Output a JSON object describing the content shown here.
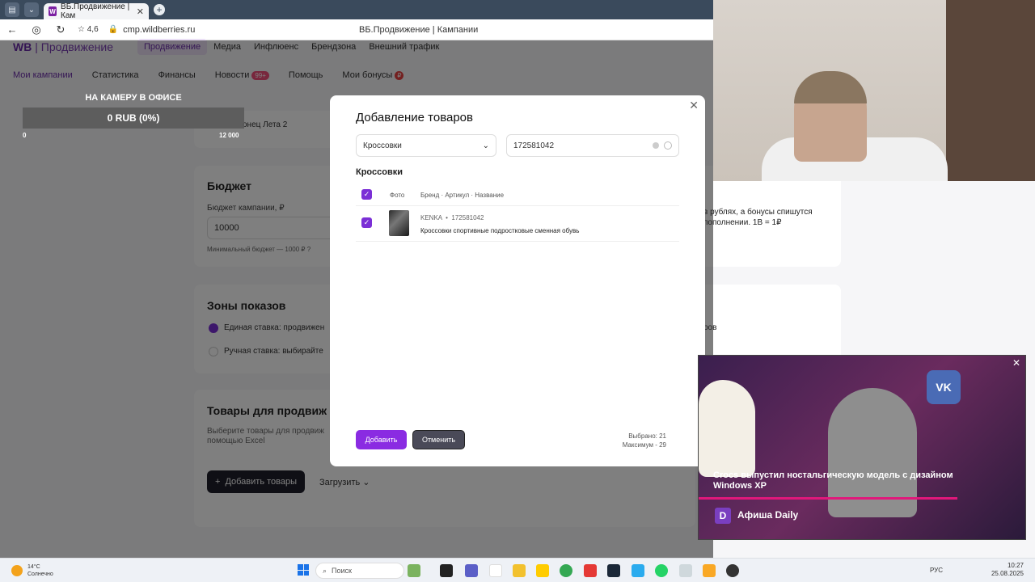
{
  "browser": {
    "tab_title": "ВБ.Продвижение | Кам",
    "rating": "4,6",
    "url": "cmp.wildberries.ru",
    "page_title": "ВБ.Продвижение | Кампании"
  },
  "header": {
    "logo": "WB",
    "logo_sub": "Продвижение",
    "topnav": [
      "Продвижение",
      "Медиа",
      "Инфлюенс",
      "Брендзона",
      "Внешний трафик"
    ],
    "subnav": [
      "Мои кампании",
      "Статистика",
      "Финансы",
      "Новости",
      "Помощь",
      "Мои бонусы"
    ],
    "news_badge": "99+",
    "bonus_badge": "₽"
  },
  "campaign": {
    "name_partial": "онец Лета 2",
    "budget_title": "Бюджет",
    "budget_label": "Бюджет кампании, ₽",
    "budget_value": "10000",
    "budget_hint": "Минимальный бюджет — 1000 ₽",
    "budget_info": "?",
    "budget_info_right": "в рублях, а бонусы спишутся\nпополнении. 1В = 1₽",
    "zones_title": "Зоны показов",
    "zone1": "Единая ставка: продвижен",
    "zone2": "Ручная ставка: выбирайте",
    "zones_right": "ров",
    "goods_title": "Товары для продвиж",
    "goods_hint": "Выберите товары для продвиж\nпомощью Excel",
    "add_goods_button": "Добавить товары",
    "upload_button": "Загрузить"
  },
  "overlay_widget": {
    "title": "НА КАМЕРУ В ОФИСЕ",
    "value": "0 RUB (0%)",
    "min": "0",
    "max": "12 000"
  },
  "modal": {
    "title": "Добавление товаров",
    "category": "Кроссовки",
    "search_value": "172581042",
    "section": "Кроссовки",
    "col_photo": "Фото",
    "col_info": "Бренд · Артикул · Название",
    "product_brand": "KENKA",
    "product_sku": "172581042",
    "product_name": "Кроссовки спортивные подростковые сменная обувь",
    "add_button": "Добавить",
    "cancel_button": "Отменить",
    "selected": "Выбрано: 21",
    "max": "Максимум - 29"
  },
  "video": {
    "caption": "Crocs выпустил ностальгическую модель с дизайном Windows XP",
    "brand": "Афиша Daily",
    "brand_logo": "D",
    "vk": "VK"
  },
  "taskbar": {
    "temp": "14°C",
    "weather": "Солнечно",
    "search": "Поиск",
    "lang": "РУС",
    "time": "10:27",
    "date": "25.08.2025"
  }
}
